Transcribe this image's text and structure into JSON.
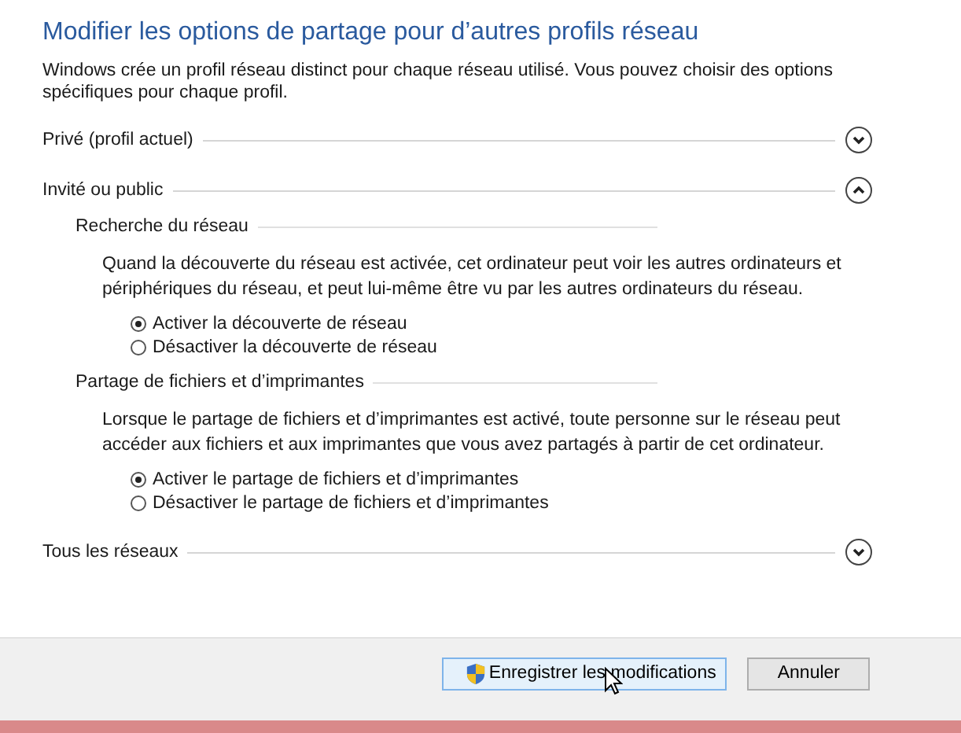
{
  "title": "Modifier les options de partage pour d’autres profils réseau",
  "description": "Windows crée un profil réseau distinct pour chaque réseau utilisé. Vous pouvez choisir des options spécifiques pour chaque profil.",
  "profiles": [
    {
      "label": "Privé (profil actuel)",
      "expanded": false
    },
    {
      "label": "Invité ou public",
      "expanded": true,
      "groups": [
        {
          "title": "Recherche du réseau",
          "text": "Quand la découverte du réseau est activée, cet ordinateur peut voir les autres ordinateurs et périphériques du réseau, et peut lui-même être vu par les autres ordinateurs du réseau.",
          "options": [
            {
              "label": "Activer la découverte de réseau",
              "selected": true
            },
            {
              "label": "Désactiver la découverte de réseau",
              "selected": false
            }
          ]
        },
        {
          "title": "Partage de fichiers et d’imprimantes",
          "text": "Lorsque le partage de fichiers et d’imprimantes est activé, toute personne sur le réseau peut accéder aux fichiers et aux imprimantes que vous avez partagés à partir de cet ordinateur.",
          "options": [
            {
              "label": "Activer le partage de fichiers et d’imprimantes",
              "selected": true
            },
            {
              "label": "Désactiver le partage de fichiers et d’imprimantes",
              "selected": false
            }
          ]
        }
      ]
    },
    {
      "label": "Tous les réseaux",
      "expanded": false
    }
  ],
  "buttons": [
    {
      "label": "Enregistrer les modifications",
      "kind": "shield"
    },
    {
      "label": "Annuler",
      "kind": "plain"
    }
  ]
}
